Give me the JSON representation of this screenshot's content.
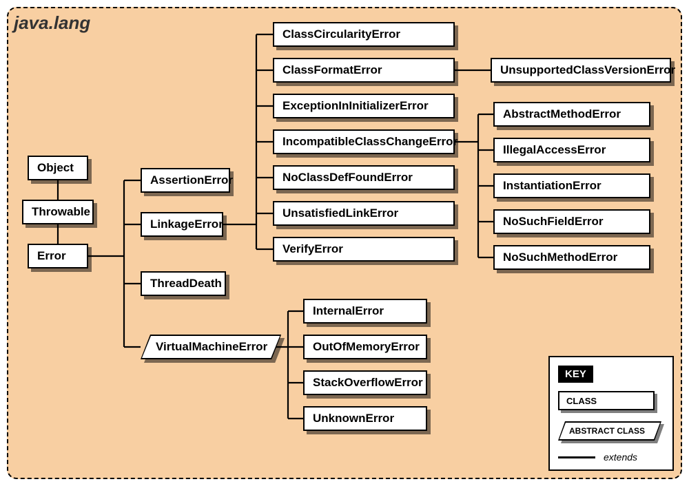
{
  "package": "java.lang",
  "root_chain": [
    "Object",
    "Throwable",
    "Error"
  ],
  "error_children": {
    "AssertionError": {
      "abstract": false,
      "children": []
    },
    "LinkageError": {
      "abstract": false,
      "children": [
        {
          "name": "ClassCircularityError",
          "children": []
        },
        {
          "name": "ClassFormatError",
          "children": [
            "UnsupportedClassVersionError"
          ]
        },
        {
          "name": "ExceptionInInitializerError",
          "children": []
        },
        {
          "name": "IncompatibleClassChangeError",
          "children": [
            "AbstractMethodError",
            "IllegalAccessError",
            "InstantiationError",
            "NoSuchFieldError",
            "NoSuchMethodError"
          ]
        },
        {
          "name": "NoClassDefFoundError",
          "children": []
        },
        {
          "name": "UnsatisfiedLinkError",
          "children": []
        },
        {
          "name": "VerifyError",
          "children": []
        }
      ]
    },
    "ThreadDeath": {
      "abstract": false,
      "children": []
    },
    "VirtualMachineError": {
      "abstract": true,
      "children": [
        "InternalError",
        "OutOfMemoryError",
        "StackOverflowError",
        "UnknownError"
      ]
    }
  },
  "key": {
    "title": "KEY",
    "class_label": "CLASS",
    "abstract_label": "ABSTRACT CLASS",
    "extends_label": "extends"
  },
  "chart_data": {
    "type": "tree",
    "title": "java.lang Error hierarchy",
    "root": "Object",
    "edges": [
      [
        "Object",
        "Throwable"
      ],
      [
        "Throwable",
        "Error"
      ],
      [
        "Error",
        "AssertionError"
      ],
      [
        "Error",
        "LinkageError"
      ],
      [
        "Error",
        "ThreadDeath"
      ],
      [
        "Error",
        "VirtualMachineError"
      ],
      [
        "LinkageError",
        "ClassCircularityError"
      ],
      [
        "LinkageError",
        "ClassFormatError"
      ],
      [
        "LinkageError",
        "ExceptionInInitializerError"
      ],
      [
        "LinkageError",
        "IncompatibleClassChangeError"
      ],
      [
        "LinkageError",
        "NoClassDefFoundError"
      ],
      [
        "LinkageError",
        "UnsatisfiedLinkError"
      ],
      [
        "LinkageError",
        "VerifyError"
      ],
      [
        "ClassFormatError",
        "UnsupportedClassVersionError"
      ],
      [
        "IncompatibleClassChangeError",
        "AbstractMethodError"
      ],
      [
        "IncompatibleClassChangeError",
        "IllegalAccessError"
      ],
      [
        "IncompatibleClassChangeError",
        "InstantiationError"
      ],
      [
        "IncompatibleClassChangeError",
        "NoSuchFieldError"
      ],
      [
        "IncompatibleClassChangeError",
        "NoSuchMethodError"
      ],
      [
        "VirtualMachineError",
        "InternalError"
      ],
      [
        "VirtualMachineError",
        "OutOfMemoryError"
      ],
      [
        "VirtualMachineError",
        "StackOverflowError"
      ],
      [
        "VirtualMachineError",
        "UnknownError"
      ]
    ],
    "abstract_nodes": [
      "VirtualMachineError"
    ]
  }
}
